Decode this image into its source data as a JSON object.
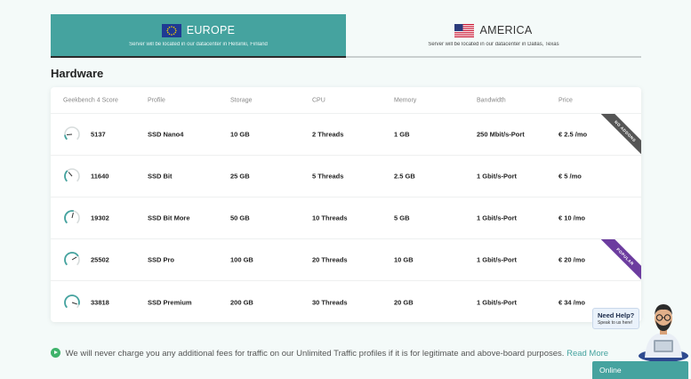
{
  "regions": [
    {
      "name": "EUROPE",
      "description": "Server will be located in our datacenter in Helsinki, Finland",
      "flag": "eu-flag",
      "active": true
    },
    {
      "name": "AMERICA",
      "description": "Server will be located in our datacenter in Dallas, Texas",
      "flag": "us-flag",
      "active": false
    }
  ],
  "section_title": "Hardware",
  "table": {
    "headers": [
      "Geekbench 4 Score",
      "Profile",
      "Storage",
      "CPU",
      "Memory",
      "Bandwidth",
      "Price"
    ],
    "rows": [
      {
        "score": "5137",
        "profile": "SSD Nano4",
        "storage": "10 GB",
        "cpu": "2 Threads",
        "memory": "1 GB",
        "bandwidth": "250 Mbit/s-Port",
        "price": "€ 2.5 /mo",
        "gauge_level": 0.15,
        "ribbon": "NO ADDONS"
      },
      {
        "score": "11640",
        "profile": "SSD Bit",
        "storage": "25 GB",
        "cpu": "5 Threads",
        "memory": "2.5 GB",
        "bandwidth": "1 Gbit/s-Port",
        "price": "€ 5 /mo",
        "gauge_level": 0.35,
        "ribbon": ""
      },
      {
        "score": "19302",
        "profile": "SSD Bit More",
        "storage": "50 GB",
        "cpu": "10 Threads",
        "memory": "5 GB",
        "bandwidth": "1 Gbit/s-Port",
        "price": "€ 10 /mo",
        "gauge_level": 0.55,
        "ribbon": ""
      },
      {
        "score": "25502",
        "profile": "SSD Pro",
        "storage": "100 GB",
        "cpu": "20 Threads",
        "memory": "10 GB",
        "bandwidth": "1 Gbit/s-Port",
        "price": "€ 20 /mo",
        "gauge_level": 0.72,
        "ribbon": "POPULAR"
      },
      {
        "score": "33818",
        "profile": "SSD Premium",
        "storage": "200 GB",
        "cpu": "30 Threads",
        "memory": "20 GB",
        "bandwidth": "1 Gbit/s-Port",
        "price": "€ 34 /mo",
        "gauge_level": 0.9,
        "ribbon": ""
      }
    ]
  },
  "note": {
    "text": "We will never charge you any additional fees for traffic on our Unlimited Traffic profiles if it is for legitimate and above-board purposes.",
    "link": "Read More"
  },
  "chat": {
    "title": "Need Help?",
    "subtitle": "Speak to us here!",
    "status": "Online"
  },
  "colors": {
    "accent": "#45a39f",
    "ribbon_gray": "#555555",
    "ribbon_purple": "#6c3c9f",
    "info_green": "#3fb36b"
  }
}
